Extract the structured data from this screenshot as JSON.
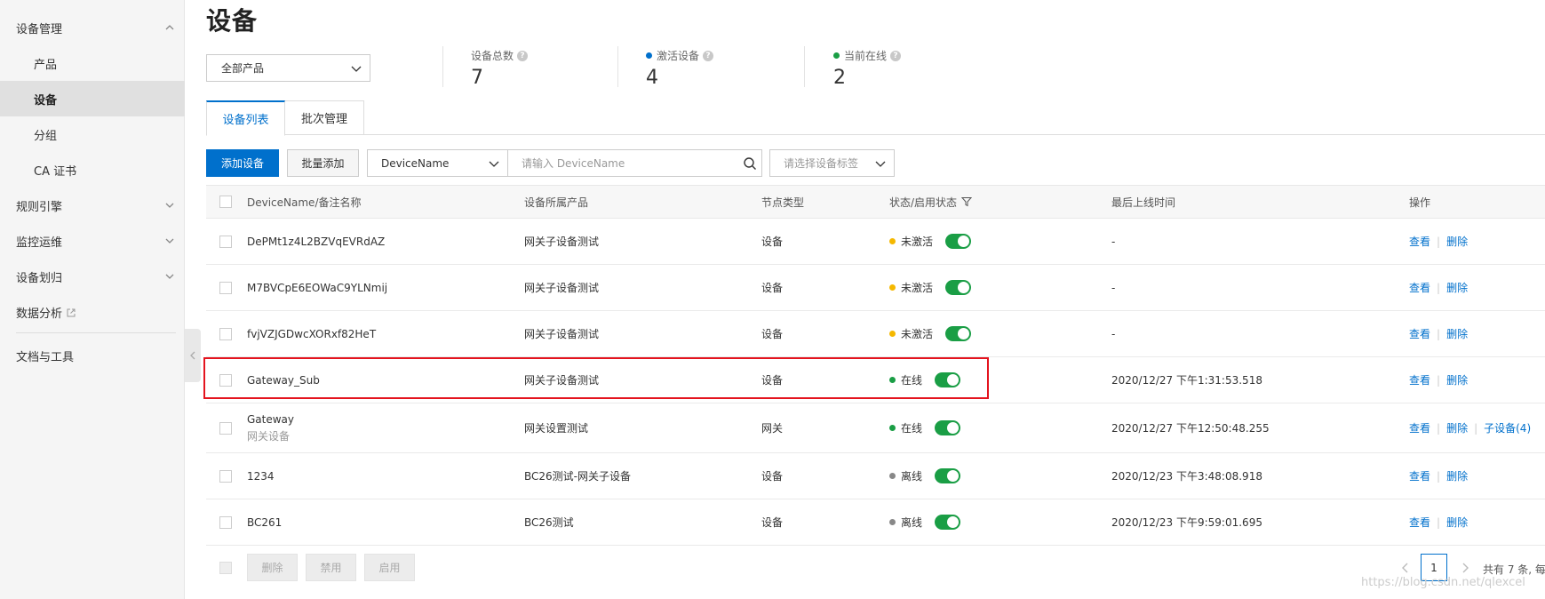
{
  "sidebar": {
    "items": [
      {
        "label": "设备管理",
        "expanded": true
      },
      {
        "label": "产品"
      },
      {
        "label": "设备",
        "active": true
      },
      {
        "label": "分组"
      },
      {
        "label": "CA 证书"
      },
      {
        "label": "规则引擎"
      },
      {
        "label": "监控运维"
      },
      {
        "label": "设备划归"
      },
      {
        "label": "数据分析"
      },
      {
        "label": "文档与工具"
      }
    ]
  },
  "page": {
    "title": "设备"
  },
  "product_select": {
    "value": "全部产品"
  },
  "stats": {
    "total": {
      "label": "设备总数",
      "value": "7"
    },
    "active": {
      "label": "激活设备",
      "value": "4",
      "color": "#0070cc"
    },
    "online": {
      "label": "当前在线",
      "value": "2",
      "color": "#1a9e45"
    }
  },
  "tabs": [
    {
      "label": "设备列表",
      "active": true
    },
    {
      "label": "批次管理"
    }
  ],
  "toolbar": {
    "add_label": "添加设备",
    "batch_add_label": "批量添加",
    "filter_field": "DeviceName",
    "search_placeholder": "请输入 DeviceName",
    "tag_placeholder": "请选择设备标签"
  },
  "table": {
    "columns": [
      "DeviceName/备注名称",
      "设备所属产品",
      "节点类型",
      "状态/启用状态",
      "最后上线时间",
      "操作"
    ],
    "rows": [
      {
        "name": "DePMt1z4L2BZVqEVRdAZ",
        "product": "网关子设备测试",
        "node": "设备",
        "status": "未激活",
        "status_color": "#f5b800",
        "last_online": "-",
        "view": "查看",
        "delete": "删除"
      },
      {
        "name": "M7BVCpE6EOWaC9YLNmij",
        "product": "网关子设备测试",
        "node": "设备",
        "status": "未激活",
        "status_color": "#f5b800",
        "last_online": "-",
        "view": "查看",
        "delete": "删除"
      },
      {
        "name": "fvjVZJGDwcXORxf82HeT",
        "product": "网关子设备测试",
        "node": "设备",
        "status": "未激活",
        "status_color": "#f5b800",
        "last_online": "-",
        "view": "查看",
        "delete": "删除"
      },
      {
        "name": "Gateway_Sub",
        "product": "网关子设备测试",
        "node": "设备",
        "status": "在线",
        "status_color": "#1a9e45",
        "last_online": "2020/12/27 下午1:31:53.518",
        "view": "查看",
        "delete": "删除"
      },
      {
        "name": "Gateway",
        "note": "网关设备",
        "product": "网关设置测试",
        "node": "网关",
        "status": "在线",
        "status_color": "#1a9e45",
        "last_online": "2020/12/27 下午12:50:48.255",
        "view": "查看",
        "delete": "删除",
        "children": "子设备(4)"
      },
      {
        "name": "1234",
        "product": "BC26测试-网关子设备",
        "node": "设备",
        "status": "离线",
        "status_color": "#888888",
        "last_online": "2020/12/23 下午3:48:08.918",
        "view": "查看",
        "delete": "删除"
      },
      {
        "name": "BC261",
        "product": "BC26测试",
        "node": "设备",
        "status": "离线",
        "status_color": "#888888",
        "last_online": "2020/12/23 下午9:59:01.695",
        "view": "查看",
        "delete": "删除"
      }
    ]
  },
  "footer": {
    "delete_label": "删除",
    "disable_label": "禁用",
    "enable_label": "启用",
    "page": "1",
    "total_text": "共有 7 条, 每"
  },
  "watermark": "https://blog.csdn.net/qlexcel",
  "colors": {
    "accent": "#0070cc",
    "highlight": "#e4141e"
  }
}
